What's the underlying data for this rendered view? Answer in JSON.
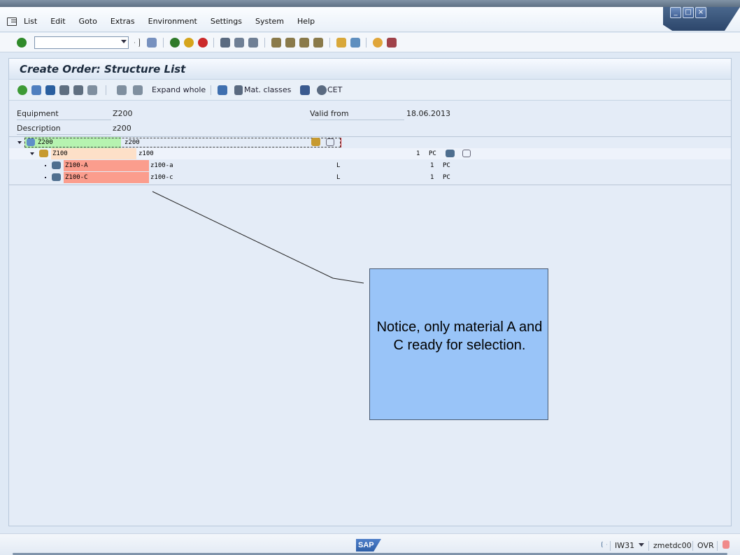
{
  "menu": {
    "items": [
      "List",
      "Edit",
      "Goto",
      "Extras",
      "Environment",
      "Settings",
      "System",
      "Help"
    ]
  },
  "window_controls": {
    "minimize": "_",
    "maximize": "□",
    "close": "×"
  },
  "command_field": {
    "value": ""
  },
  "screen": {
    "title": "Create Order: Structure List"
  },
  "app_toolbar": {
    "expand_whole_label": "Expand whole",
    "mat_classes_label": "Mat. classes",
    "cet_label": "CET"
  },
  "header": {
    "equipment_label": "Equipment",
    "equipment_value": "Z200",
    "description_label": "Description",
    "description_value": "z200",
    "valid_from_label": "Valid from",
    "valid_from_value": "18.06.2013"
  },
  "tree": {
    "rows": [
      {
        "id": "Z200",
        "desc": "z200",
        "type": "",
        "qty": "",
        "unit": "",
        "bg": "#b6f3b0"
      },
      {
        "id": "Z100",
        "desc": "z100",
        "type": "",
        "qty": "1",
        "unit": "PC",
        "bg": "#fde0c8"
      },
      {
        "id": "Z100-A",
        "desc": "z100-a",
        "type": "L",
        "qty": "1",
        "unit": "PC",
        "bg": "#fb9d8d"
      },
      {
        "id": "Z100-C",
        "desc": "z100-c",
        "type": "L",
        "qty": "1",
        "unit": "PC",
        "bg": "#fb9d8d"
      }
    ]
  },
  "callout": {
    "text": "Notice, only material A and C ready for selection."
  },
  "status": {
    "logo": "SAP",
    "transaction": "IW31",
    "server": "zmetdc00",
    "mode": "OVR"
  },
  "colors": {
    "accent": "#2d5fa8",
    "callout_bg": "#99c4f8",
    "highlight_green": "#b6f3b0",
    "highlight_red": "#fb9d8d"
  }
}
